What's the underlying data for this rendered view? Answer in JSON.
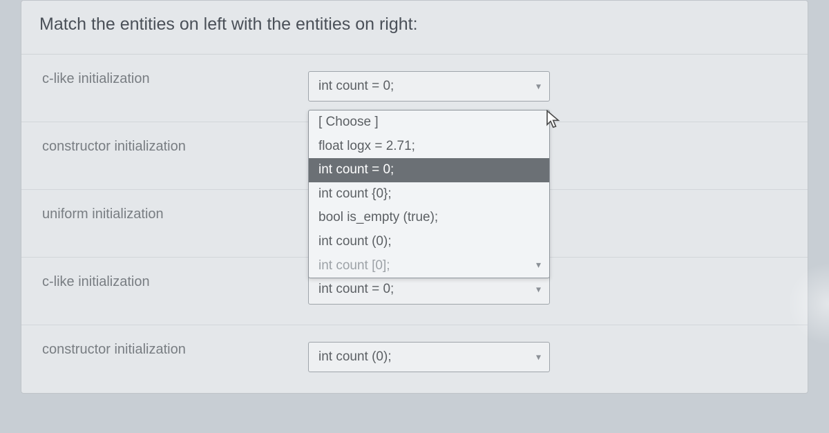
{
  "prompt": "Match the entities on left with the entities on right:",
  "rows": [
    {
      "label": "c-like initialization",
      "selected": "int count = 0;"
    },
    {
      "label": "constructor initialization",
      "selected": ""
    },
    {
      "label": "uniform initialization",
      "selected": ""
    },
    {
      "label": "c-like initialization",
      "selected": "int count = 0;"
    },
    {
      "label": "constructor initialization",
      "selected": "int count (0);"
    }
  ],
  "dropdown": {
    "options": [
      "[ Choose ]",
      "float logx = 2.71;",
      "int count = 0;",
      "int count {0};",
      "bool is_empty (true);",
      "int count (0);",
      "int count [0];"
    ],
    "highlighted_index": 2
  }
}
